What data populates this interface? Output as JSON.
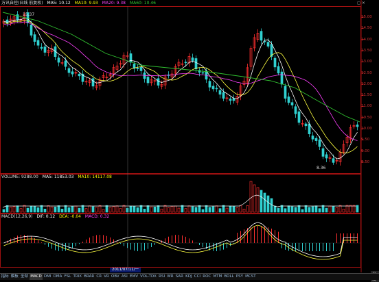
{
  "header": {
    "title": "万讯自控(日线 前复权)",
    "ma5": "MA5: 10.12",
    "ma10": "MA10: 9.93",
    "ma20": "MA20: 9.38",
    "ma60": "MA60: 10.46"
  },
  "price_axis": [
    "15.00",
    "14.50",
    "14.00",
    "13.50",
    "13.00",
    "12.50",
    "12.00",
    "11.50",
    "11.00",
    "10.50",
    "10.00",
    "9.50",
    "9.00",
    "8.50"
  ],
  "price_high_label": "15.37",
  "price_low_label": "8.36",
  "volume": {
    "label": "VOLUME: 9288.00",
    "ma5": "MA5: 11853.03",
    "ma10": "MA10: 14117.08"
  },
  "macd": {
    "label": "MACD(12,26,9)",
    "dif": "DIF: 0.12",
    "dea": "DEA: -0.04",
    "macd": "MACD: 0.32"
  },
  "date_label": "2011/07/11/一",
  "tabs": [
    "指标",
    "模板",
    "全部",
    "MACD",
    "DMI",
    "DMA",
    "FSL",
    "TRIX",
    "BRAR",
    "CR",
    "VR",
    "OBV",
    "ASI",
    "EMV",
    "VOL-TDX",
    "RSI",
    "WR",
    "SAR",
    "KDJ",
    "CCI",
    "ROC",
    "MTM",
    "BOLL",
    "PSY",
    "MCST"
  ],
  "day_button": "日线",
  "colors": {
    "up": "#ff3030",
    "down": "#30d0d0",
    "ma5": "#ffffff",
    "ma10": "#ffff40",
    "ma20": "#ff40ff",
    "ma60": "#30c030",
    "axis": "#a01010"
  }
}
